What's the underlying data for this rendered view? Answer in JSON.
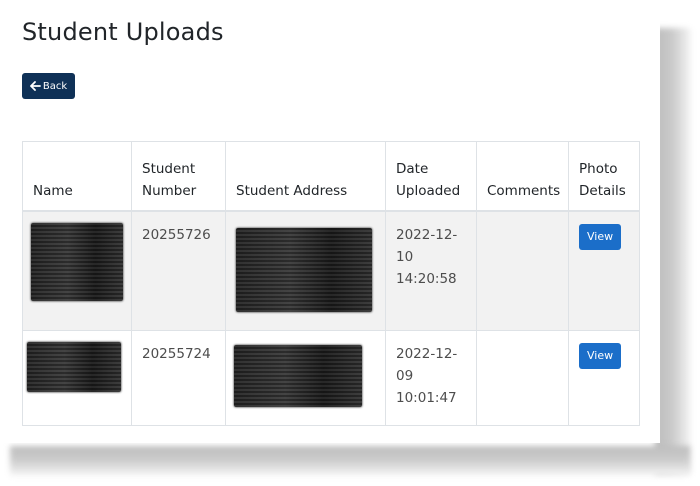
{
  "page": {
    "title": "Student Uploads",
    "back_label": "Back"
  },
  "table": {
    "headers": {
      "name": "Name",
      "student_number": [
        "Student",
        "Number"
      ],
      "address": "Student Address",
      "date": [
        "Date",
        "Uploaded"
      ],
      "comments": "Comments",
      "photo": [
        "Photo",
        "Details"
      ]
    },
    "rows": [
      {
        "name_redacted": true,
        "student_number": "20255726",
        "address_redacted": true,
        "date_parts": [
          "2022-12-",
          "10",
          "14:20:58"
        ],
        "comments": "",
        "view_label": "View"
      },
      {
        "name_redacted": true,
        "student_number": "20255724",
        "address_redacted": true,
        "date_parts": [
          "2022-12-",
          "09",
          "10:01:47"
        ],
        "comments": "",
        "view_label": "View"
      }
    ]
  },
  "colors": {
    "back_button": "#0f3157",
    "view_button": "#1b6ec9",
    "striped_row": "#f2f2f2",
    "border": "#dee2e6"
  },
  "icons": {
    "back": "arrow-left-icon"
  }
}
